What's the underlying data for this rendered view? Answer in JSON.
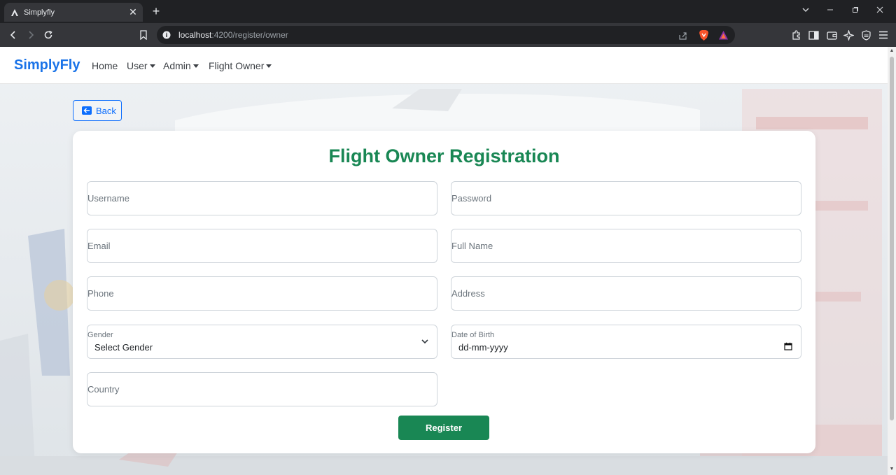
{
  "browser": {
    "tab_title": "Simplyfly",
    "new_tab_symbol": "+",
    "url_host": "localhost",
    "url_rest": ":4200/register/owner"
  },
  "navbar": {
    "brand": "SimplyFly",
    "links": [
      "Home",
      "User",
      "Admin",
      "Flight Owner"
    ]
  },
  "back_button": {
    "label": "Back"
  },
  "form": {
    "title": "Flight Owner Registration",
    "username_placeholder": "Username",
    "password_placeholder": "Password",
    "email_placeholder": "Email",
    "fullname_placeholder": "Full Name",
    "phone_placeholder": "Phone",
    "address_placeholder": "Address",
    "gender_label": "Gender",
    "gender_value": "Select Gender",
    "dob_label": "Date of Birth",
    "dob_value": "dd-mm-yyyy",
    "country_placeholder": "Country",
    "register_label": "Register"
  },
  "colors": {
    "brand": "#1a73e8",
    "title_green": "#198754",
    "back_blue": "#0d6efd",
    "chrome_dark": "#202124"
  }
}
